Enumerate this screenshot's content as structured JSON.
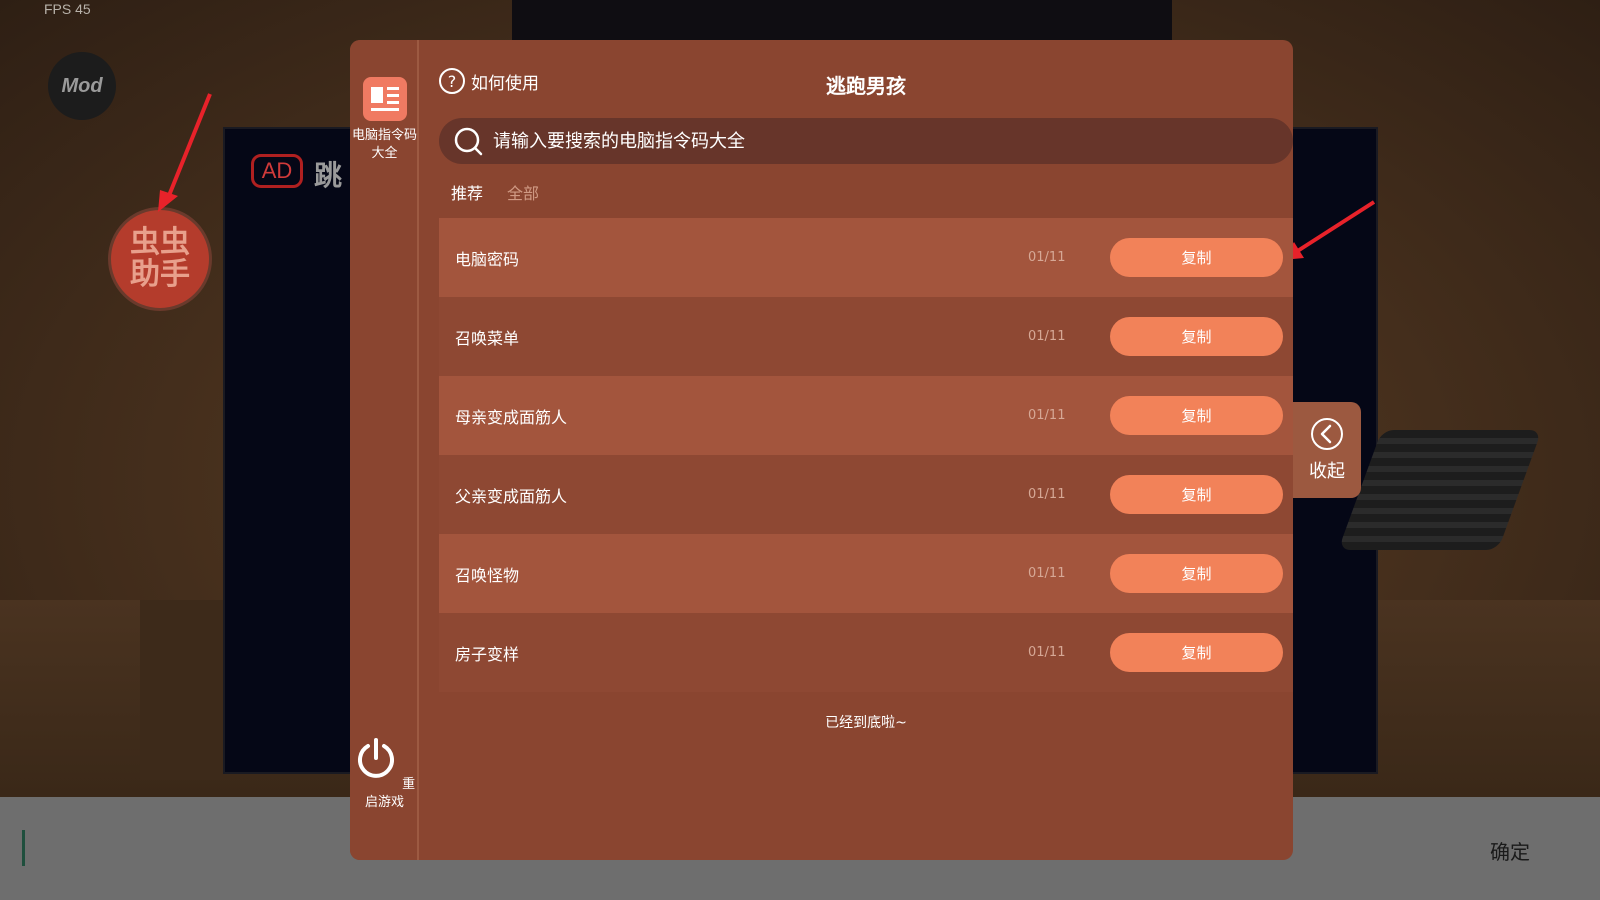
{
  "background": {
    "fps_text": "FPS 45",
    "mod_logo_text": "Mod",
    "ad_badge": "AD",
    "ad_text": "跳",
    "helper_ball_text": "虫虫\n助手"
  },
  "side_rail": {
    "commands_label": "电脑指令码大全",
    "restart_label": "重启游戏"
  },
  "header": {
    "howto_label": "如何使用",
    "title": "逃跑男孩"
  },
  "search": {
    "placeholder": "请输入要搜索的电脑指令码大全"
  },
  "tabs": [
    {
      "label": "推荐",
      "active": true
    },
    {
      "label": "全部",
      "active": false
    }
  ],
  "items": [
    {
      "label": "电脑密码",
      "date": "01/11",
      "button": "复制"
    },
    {
      "label": "召唤菜单",
      "date": "01/11",
      "button": "复制"
    },
    {
      "label": "母亲变成面筋人",
      "date": "01/11",
      "button": "复制"
    },
    {
      "label": "父亲变成面筋人",
      "date": "01/11",
      "button": "复制"
    },
    {
      "label": "召唤怪物",
      "date": "01/11",
      "button": "复制"
    },
    {
      "label": "房子变样",
      "date": "01/11",
      "button": "复制"
    }
  ],
  "end_text": "已经到底啦~",
  "collapse": {
    "label": "收起"
  },
  "bottom_bar": {
    "confirm_label": "确定"
  },
  "colors": {
    "panel": "#8a4530",
    "row_light": "#a3553d",
    "row_dark": "#8e4833",
    "button": "#f28259",
    "annotation_arrow": "#e8222a"
  }
}
